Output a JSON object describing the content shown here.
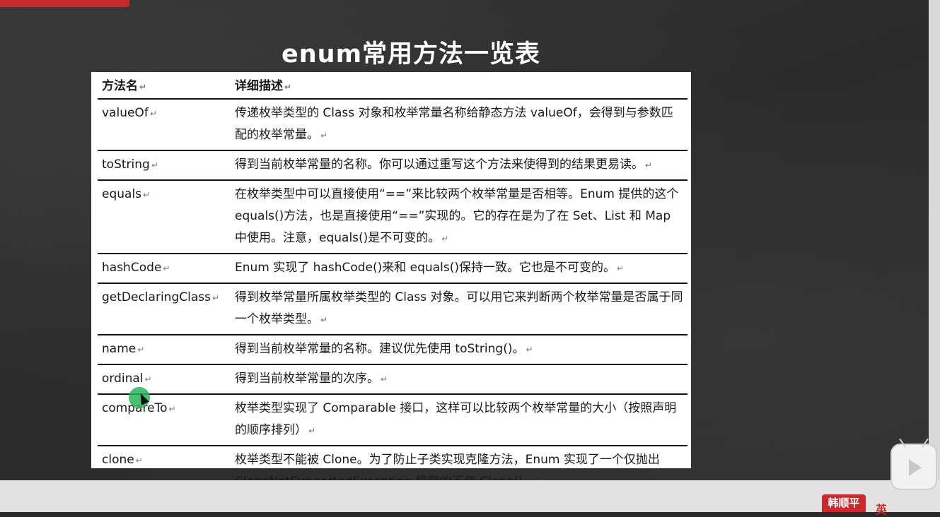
{
  "slide": {
    "title": "enum常用方法一览表"
  },
  "table": {
    "headers": [
      "方法名",
      "详细描述"
    ],
    "rows": [
      {
        "name": "valueOf",
        "desc": "传递枚举类型的 Class 对象和枚举常量名称给静态方法 valueOf，会得到与参数匹配的枚举常量。"
      },
      {
        "name": "toString",
        "desc": "得到当前枚举常量的名称。你可以通过重写这个方法来使得到的结果更易读。"
      },
      {
        "name": "equals",
        "desc": "在枚举类型中可以直接使用“==”来比较两个枚举常量是否相等。Enum 提供的这个 equals()方法，也是直接使用“==”实现的。它的存在是为了在 Set、List 和 Map 中使用。注意，equals()是不可变的。"
      },
      {
        "name": "hashCode",
        "desc": "Enum 实现了 hashCode()来和 equals()保持一致。它也是不可变的。"
      },
      {
        "name": "getDeclaringClass",
        "desc": "得到枚举常量所属枚举类型的 Class 对象。可以用它来判断两个枚举常量是否属于同一个枚举类型。"
      },
      {
        "name": "name",
        "desc": "得到当前枚举常量的名称。建议优先使用 toString()。"
      },
      {
        "name": "ordinal",
        "desc": "得到当前枚举常量的次序。"
      },
      {
        "name": "compareTo",
        "desc": "枚举类型实现了 Comparable 接口，这样可以比较两个枚举常量的大小（按照声明的顺序排列）"
      },
      {
        "name": "clone",
        "desc": "枚举类型不能被 Clone。为了防止子类实现克隆方法，Enum 实现了一个仅抛出 CloneNotSupportedException 异常的不变 Clone()。"
      }
    ],
    "return_mark": "↵"
  },
  "overlay": {
    "author_tag": "韩顺平",
    "ime_indicator": "英"
  },
  "colors": {
    "brand_red": "#c62a2a",
    "board": "#2e2e2e",
    "cursor_highlight": "#28b45a"
  },
  "icons": [
    "video-player-icon",
    "play-icon",
    "cursor-arrow-icon"
  ]
}
